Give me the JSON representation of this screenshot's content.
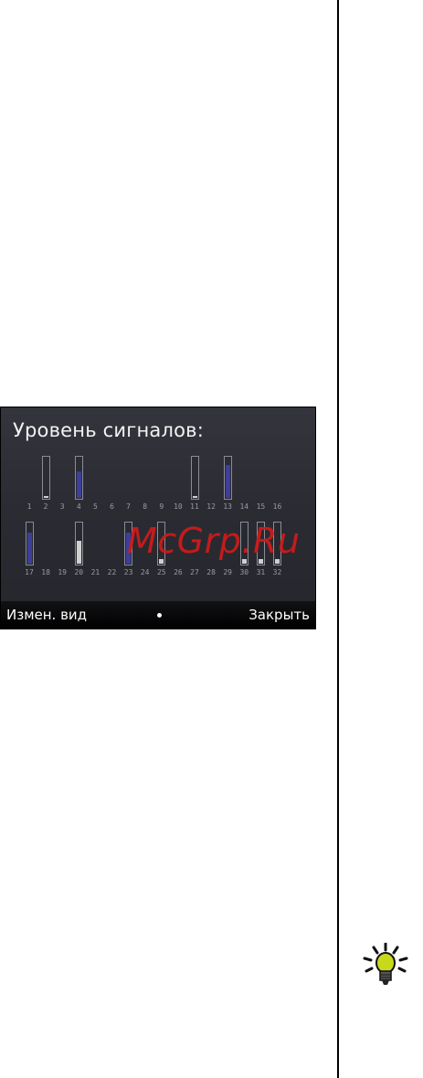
{
  "screen": {
    "title": "Уровень сигналов:",
    "softkeys": {
      "left": "Измен. вид",
      "right": "Закрыть"
    }
  },
  "watermark": "McGrp.Ru",
  "satellites": {
    "row1": [
      {
        "id": "1",
        "level": 0
      },
      {
        "id": "2",
        "level": 0.05
      },
      {
        "id": "3",
        "level": 0
      },
      {
        "id": "4",
        "level": 0.65
      },
      {
        "id": "5",
        "level": 0
      },
      {
        "id": "6",
        "level": 0
      },
      {
        "id": "7",
        "level": 0
      },
      {
        "id": "8",
        "level": 0
      },
      {
        "id": "9",
        "level": 0
      },
      {
        "id": "10",
        "level": 0
      },
      {
        "id": "11",
        "level": 0.05
      },
      {
        "id": "12",
        "level": 0
      },
      {
        "id": "13",
        "level": 0.8
      },
      {
        "id": "14",
        "level": 0
      },
      {
        "id": "15",
        "level": 0
      },
      {
        "id": "16",
        "level": 0
      }
    ],
    "row2": [
      {
        "id": "17",
        "level": 0.75
      },
      {
        "id": "18",
        "level": 0
      },
      {
        "id": "19",
        "level": 0
      },
      {
        "id": "20",
        "level": 0.55
      },
      {
        "id": "21",
        "level": 0
      },
      {
        "id": "22",
        "level": 0
      },
      {
        "id": "23",
        "level": 0.75
      },
      {
        "id": "24",
        "level": 0
      },
      {
        "id": "25",
        "level": 0.1
      },
      {
        "id": "26",
        "level": 0
      },
      {
        "id": "27",
        "level": 0
      },
      {
        "id": "28",
        "level": 0
      },
      {
        "id": "29",
        "level": 0
      },
      {
        "id": "30",
        "level": 0.1
      },
      {
        "id": "31",
        "level": 0.1
      },
      {
        "id": "32",
        "level": 0.1
      }
    ]
  },
  "colors": {
    "strong": "#3d3f9a",
    "medium": "#d0d0d0",
    "weak": "#d0d0d0"
  },
  "icons": {
    "tip": "lightbulb-icon"
  }
}
